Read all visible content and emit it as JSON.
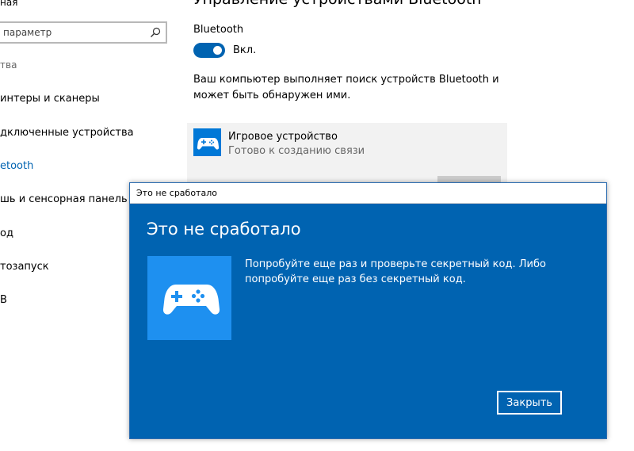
{
  "sidebar": {
    "header_text": "ная",
    "search": {
      "placeholder": "параметр"
    },
    "items": [
      {
        "label": "тва",
        "state": "header"
      },
      {
        "label": "интеры и сканеры",
        "state": "normal"
      },
      {
        "label": "дключенные устройства",
        "state": "normal"
      },
      {
        "label": "etooth",
        "state": "active"
      },
      {
        "label": "шь и сенсорная панель",
        "state": "normal"
      },
      {
        "label": "од",
        "state": "normal"
      },
      {
        "label": "тозапуск",
        "state": "normal"
      },
      {
        "label": "B",
        "state": "normal"
      }
    ]
  },
  "main": {
    "title": "Управление устройствами Bluetooth",
    "bluetooth_label": "Bluetooth",
    "toggle": {
      "label": "Вкл.",
      "on": true
    },
    "description": "Ваш компьютер выполняет поиск устройств Bluetooth и может быть обнаружен ими.",
    "device": {
      "name": "Игровое устройство",
      "status": "Готово к созданию связи",
      "icon": "gamepad-icon"
    }
  },
  "dialog": {
    "window_title": "Это не сработало",
    "heading": "Это не сработало",
    "message": "Попробуйте еще раз и проверьте секретный код. Либо попробуйте еще раз без секретный код.",
    "close_label": "Закрыть",
    "icon": "gamepad-icon"
  },
  "colors": {
    "accent": "#0063b1",
    "tile": "#1e90f0",
    "device_tile": "#0078d7",
    "active_nav": "#0063b1"
  }
}
